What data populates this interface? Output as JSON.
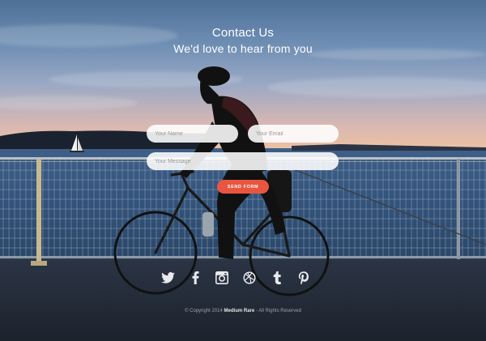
{
  "contact": {
    "title": "Contact Us",
    "subtitle": "We'd love to hear from you"
  },
  "form": {
    "name_placeholder": "Your Name",
    "email_placeholder": "Your Email",
    "message_placeholder": "Your Message",
    "submit_label": "SEND FORM"
  },
  "social": [
    {
      "icon": "twitter-icon"
    },
    {
      "icon": "facebook-icon"
    },
    {
      "icon": "instagram-icon"
    },
    {
      "icon": "dribbble-icon"
    },
    {
      "icon": "tumblr-icon"
    },
    {
      "icon": "pinterest-icon"
    }
  ],
  "footer": {
    "prefix": "© Copyright 2014",
    "brand": "Medium Rare",
    "suffix": "- All Rights Reserved"
  },
  "colors": {
    "accent": "#e8563f",
    "text": "#ffffff"
  }
}
